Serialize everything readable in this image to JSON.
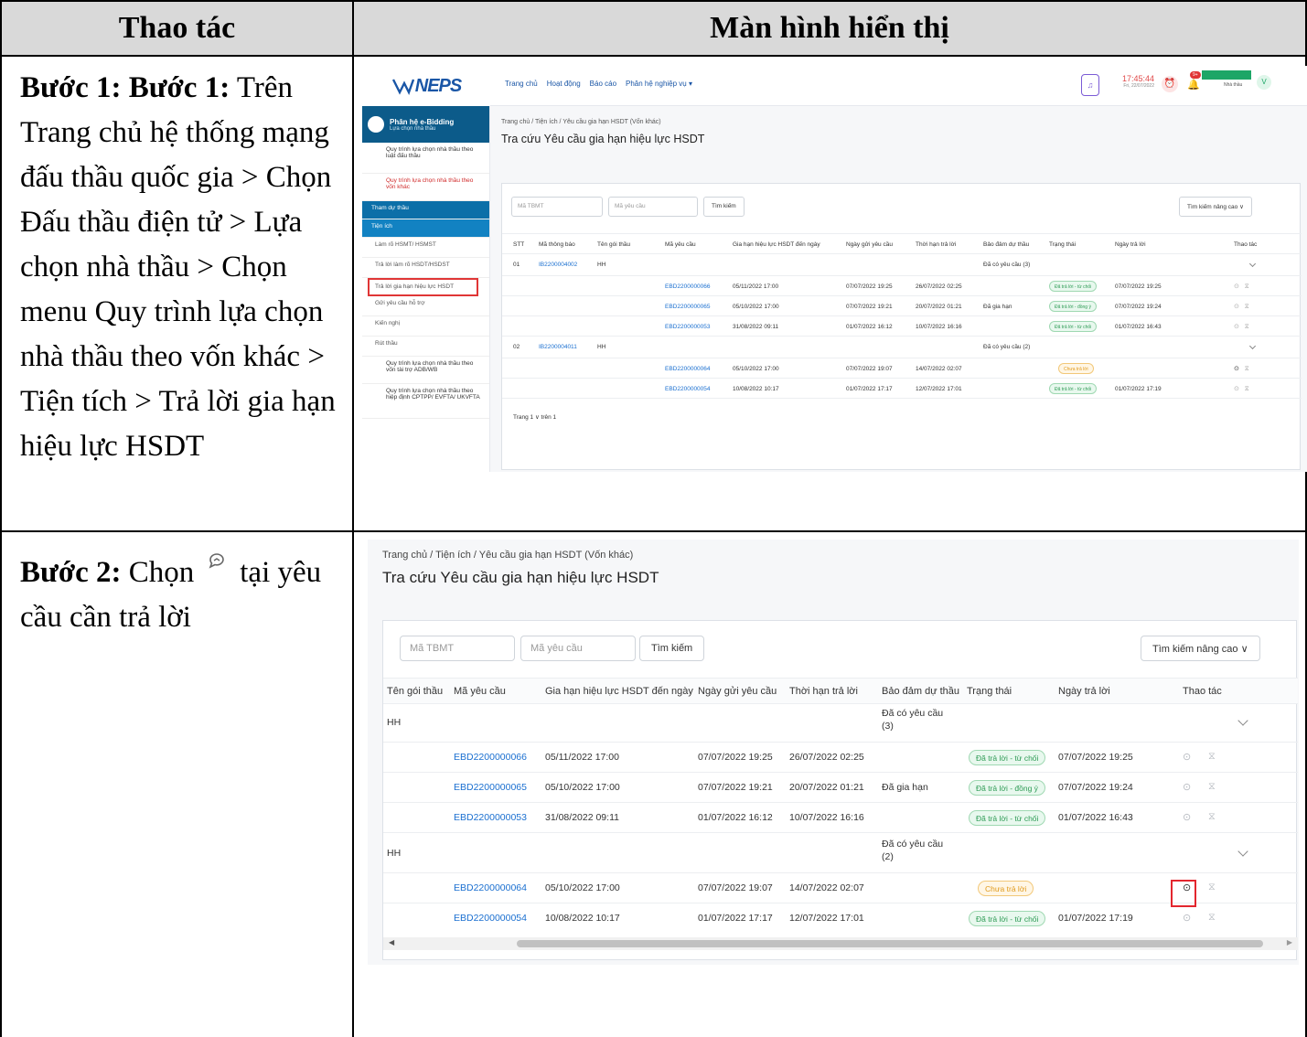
{
  "table": {
    "col1_header": "Thao tác",
    "col2_header": "Màn hình hiển thị"
  },
  "step1": {
    "label": "Bước 1: Bước 1:",
    "text": "Trên Trang chủ hệ thống mạng đấu thầu quốc gia > Chọn Đấu thầu điện tử > Lựa chọn nhà thầu > Chọn menu Quy trình lựa chọn nhà thầu theo vốn khác > Tiện tích > Trả lời gia hạn hiệu lực HSDT"
  },
  "step2": {
    "label": "Bước 2:",
    "text_before": "Chọn",
    "icon": "reply-chat-icon",
    "text_after": "tại yêu cầu cần trả lời"
  },
  "app": {
    "logo": "NEPS",
    "nav": [
      "Trang chủ",
      "Hoạt động",
      "Báo cáo",
      "Phân hệ nghiệp vụ ▾"
    ],
    "clock_time": "17:45:44",
    "clock_date": "Fri, 22/07/2022",
    "user_role": "Nhà thầu",
    "avatar": "V",
    "notif_badge": "9+",
    "module_title": "Phân hệ e-Bidding",
    "module_sub": "Lựa chọn nhà thầu",
    "sidebar": [
      "Quy trình lựa chọn nhà thầu theo luật đấu thầu",
      "Quy trình lựa chọn nhà thầu theo vốn khác",
      "Tham dự thầu",
      "Tiện ích",
      "Làm rõ HSMT/ HSMST",
      "Trả lời làm rõ HSDT/HSDST",
      "Trả lời gia hạn hiệu lực HSDT",
      "Gửi yêu cầu hỗ trợ",
      "Kiến nghị",
      "Rút thầu",
      "Quy trình lựa chọn nhà thầu theo vốn tài trợ ADB/WB",
      "Quy trình lựa chọn nhà thầu theo hiệp định CPTPP/ EVFTA/ UKVFTA"
    ],
    "breadcrumb": "Trang chủ  /  Tiện ích  /  Yêu cầu gia hạn HSDT (Vốn khác)",
    "page_title": "Tra cứu Yêu cầu gia hạn hiệu lực HSDT",
    "search": {
      "tbmt_placeholder": "Mã TBMT",
      "request_placeholder": "Mã yêu cầu",
      "search_button": "Tìm kiếm",
      "advanced_button": "Tìm kiếm nâng cao ∨"
    },
    "columns": [
      "STT",
      "Mã thông báo",
      "Tên gói thầu",
      "Mã yêu cầu",
      "Gia hạn hiệu lực HSDT đến ngày",
      "Ngày gửi yêu cầu",
      "Thời hạn trả lời",
      "Bảo đảm dự thầu",
      "Trạng thái",
      "Ngày trả lời",
      "Thao tác"
    ],
    "groups": [
      {
        "stt": "01",
        "notice": "IB2200004002",
        "package": "HH",
        "requests_label": "Đã có yêu cầu (3)",
        "rows": [
          {
            "code": "EBD2200000066",
            "extend_to": "05/11/2022 17:00",
            "sent": "07/07/2022 19:25",
            "deadline": "26/07/2022 02:25",
            "guarantee": "",
            "status": "Đã trả lời - từ chối",
            "status_type": "g",
            "replied": "07/07/2022 19:25"
          },
          {
            "code": "EBD2200000065",
            "extend_to": "05/10/2022 17:00",
            "sent": "07/07/2022 19:21",
            "deadline": "20/07/2022 01:21",
            "guarantee": "Đã gia hạn",
            "status": "Đã trả lời - đồng ý",
            "status_type": "g",
            "replied": "07/07/2022 19:24"
          },
          {
            "code": "EBD2200000053",
            "extend_to": "31/08/2022 09:11",
            "sent": "01/07/2022 16:12",
            "deadline": "10/07/2022 16:16",
            "guarantee": "",
            "status": "Đã trả lời - từ chối",
            "status_type": "g",
            "replied": "01/07/2022 16:43"
          }
        ]
      },
      {
        "stt": "02",
        "notice": "IB2200004011",
        "package": "HH",
        "requests_label": "Đã có yêu cầu (2)",
        "rows": [
          {
            "code": "EBD2200000064",
            "extend_to": "05/10/2022 17:00",
            "sent": "07/07/2022 19:07",
            "deadline": "14/07/2022 02:07",
            "guarantee": "",
            "status": "Chưa trả lời",
            "status_type": "y",
            "replied": ""
          },
          {
            "code": "EBD2200000054",
            "extend_to": "10/08/2022 10:17",
            "sent": "01/07/2022 17:17",
            "deadline": "12/07/2022 17:01",
            "guarantee": "",
            "status": "Đã trả lời - từ chối",
            "status_type": "g",
            "replied": "01/07/2022 17:19"
          }
        ]
      }
    ],
    "pagination": "Trang  1  ∨  trên 1",
    "zoom_requests_label_1": "Đã có yêu cầu",
    "zoom_requests_count_1": "(3)",
    "zoom_requests_label_2": "Đã có yêu cầu",
    "zoom_requests_count_2": "(2)"
  }
}
